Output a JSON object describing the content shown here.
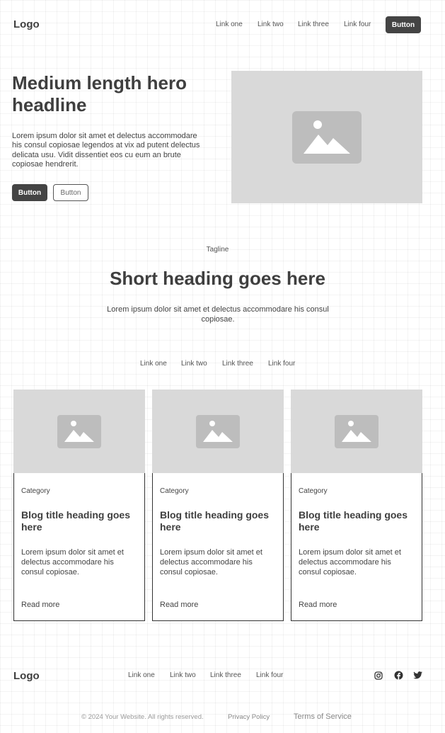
{
  "header": {
    "logo": "Logo",
    "links": [
      "Link one",
      "Link two",
      "Link three",
      "Link four"
    ],
    "button_label": "Button"
  },
  "hero": {
    "headline_line1": "Medium length hero",
    "headline_line2": "headline",
    "body": "Lorem ipsum dolor sit amet et delectus accommodare his consul copiosae legendos at vix ad putent delectus delicata usu. Vidit dissentiet eos cu eum an brute copiosae hendrerit.",
    "primary_button": "Button",
    "secondary_button": "Button",
    "image_icon": "image-icon"
  },
  "section": {
    "tagline": "Tagline",
    "heading": "Short heading goes here",
    "body": "Lorem ipsum dolor sit amet et delectus accommodare his consul copiosae.",
    "filter_links": [
      "Link one",
      "Link two",
      "Link three",
      "Link four"
    ]
  },
  "cards": [
    {
      "category": "Category",
      "title": "Blog title heading goes here",
      "description": "Lorem ipsum dolor sit amet et delectus accommodare his consul copiosae.",
      "read_more": "Read more"
    },
    {
      "category": "Category",
      "title": "Blog title heading goes here",
      "description": "Lorem ipsum dolor sit amet et delectus accommodare his consul copiosae.",
      "read_more": "Read more"
    },
    {
      "category": "Category",
      "title": "Blog title heading goes here",
      "description": "Lorem ipsum dolor sit amet et delectus accommodare his consul copiosae.",
      "read_more": "Read more"
    }
  ],
  "footer": {
    "logo": "Logo",
    "links": [
      "Link one",
      "Link two",
      "Link three",
      "Link four"
    ],
    "social_icons": [
      "instagram-icon",
      "facebook-icon",
      "twitter-icon"
    ],
    "copyright": "© 2024 Your Website. All rights reserved.",
    "privacy": "Privacy Policy",
    "terms": "Terms of Service"
  },
  "colors": {
    "accent_dark": "#444444",
    "placeholder": "#d9d9d9",
    "placeholder_icon": "#bdbdbd"
  }
}
